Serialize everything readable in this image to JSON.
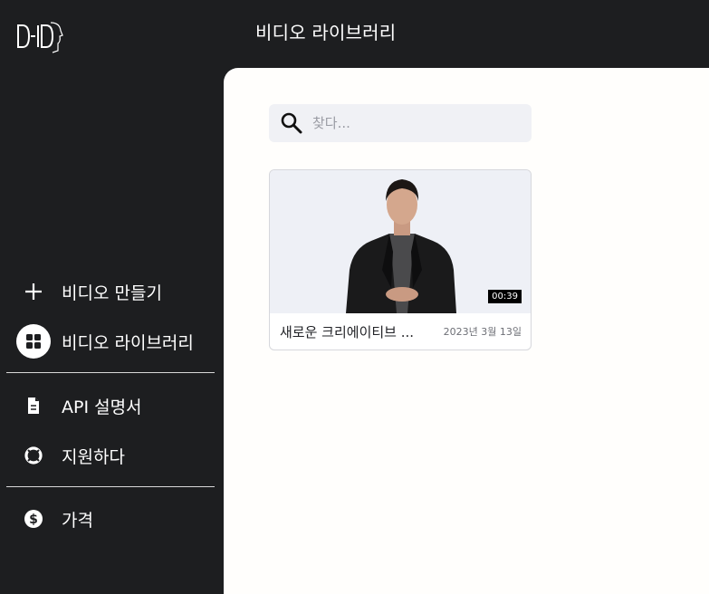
{
  "app": {
    "logo_text": "D-ID",
    "header_title": "비디오 라이브러리"
  },
  "sidebar": {
    "items": [
      {
        "label": "비디오 만들기",
        "icon": "plus-icon"
      },
      {
        "label": "비디오 라이브러리",
        "icon": "grid-icon",
        "active": true
      },
      {
        "label": "API 설명서",
        "icon": "document-icon"
      },
      {
        "label": "지원하다",
        "icon": "lifebuoy-icon"
      },
      {
        "label": "가격",
        "icon": "dollar-icon"
      }
    ]
  },
  "search": {
    "placeholder": "찾다..."
  },
  "videos": [
    {
      "title": "새로운 크리에이티브 ...",
      "date": "2023년 3월 13일",
      "duration": "00:39"
    }
  ],
  "colors": {
    "sidebar_bg": "#1d1e20",
    "main_bg": "#fffefc",
    "search_bg": "#f0f1f5",
    "thumb_bg": "#eef0f6"
  }
}
